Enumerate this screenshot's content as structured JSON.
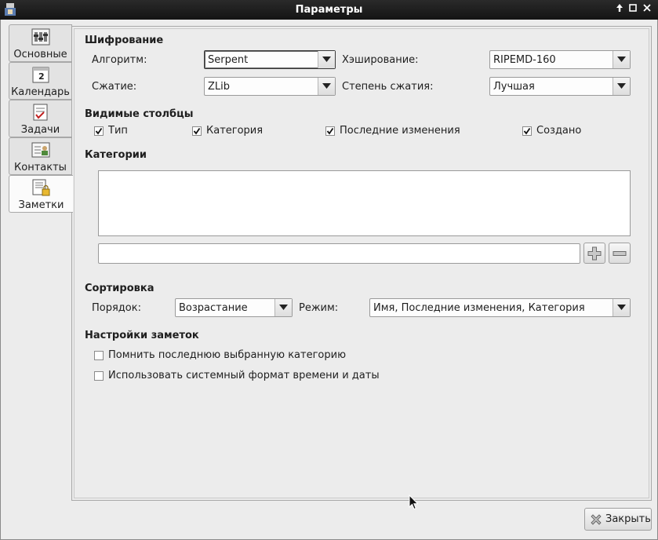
{
  "window": {
    "title": "Параметры"
  },
  "tabs": [
    {
      "label": "Основные",
      "icon": "settings-icon"
    },
    {
      "label": "Календарь",
      "icon": "calendar-icon",
      "icon_text": "2"
    },
    {
      "label": "Задачи",
      "icon": "tasks-icon"
    },
    {
      "label": "Контакты",
      "icon": "contacts-icon"
    },
    {
      "label": "Заметки",
      "icon": "notes-icon",
      "active": true
    }
  ],
  "encryption": {
    "heading": "Шифрование",
    "algorithm_label": "Алгоритм:",
    "algorithm_value": "Serpent",
    "hashing_label": "Хэширование:",
    "hashing_value": "RIPEMD-160",
    "compression_label": "Сжатие:",
    "compression_value": "ZLib",
    "compression_level_label": "Степень сжатия:",
    "compression_level_value": "Лучшая"
  },
  "visible_columns": {
    "heading": "Видимые столбцы",
    "items": [
      {
        "label": "Тип",
        "checked": true
      },
      {
        "label": "Категория",
        "checked": true
      },
      {
        "label": "Последние изменения",
        "checked": true
      },
      {
        "label": "Создано",
        "checked": true
      }
    ]
  },
  "categories": {
    "heading": "Категории",
    "items": [],
    "new_category_value": ""
  },
  "sorting": {
    "heading": "Сортировка",
    "order_label": "Порядок:",
    "order_value": "Возрастание",
    "mode_label": "Режим:",
    "mode_value": "Имя, Последние изменения, Категория"
  },
  "note_settings": {
    "heading": "Настройки заметок",
    "items": [
      {
        "label": "Помнить последнюю выбранную категорию",
        "checked": false
      },
      {
        "label": "Использовать системный формат времени и даты",
        "checked": false
      }
    ]
  },
  "footer": {
    "close_label": "Закрыть"
  },
  "colors": {
    "titlebar": "#1a1a1a",
    "background": "#ececec"
  }
}
